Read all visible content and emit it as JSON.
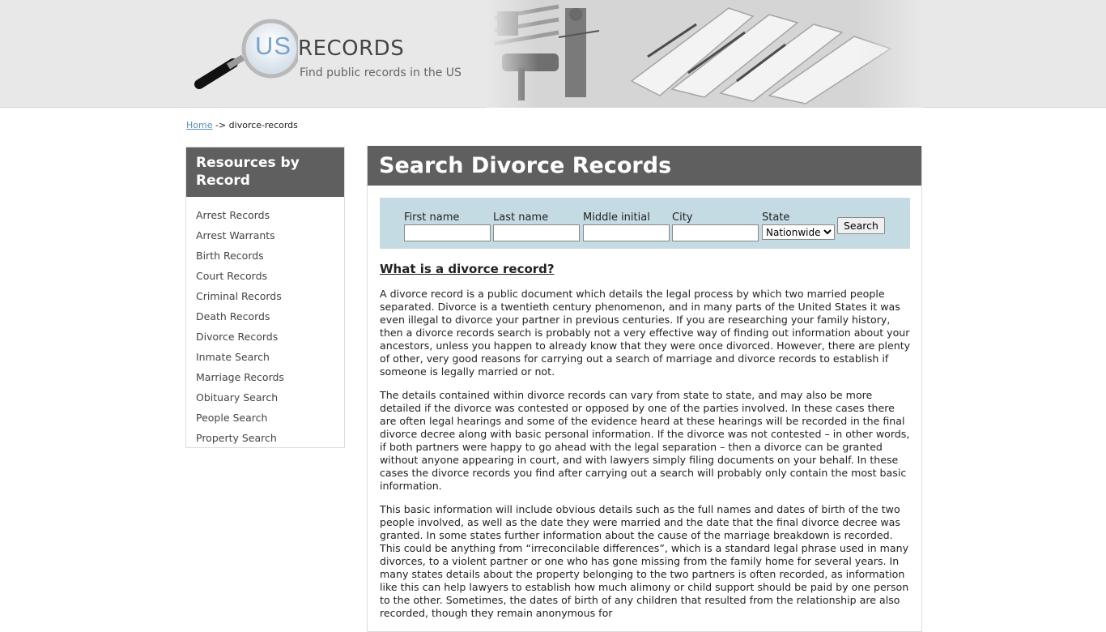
{
  "header": {
    "logo_us": "US",
    "logo_records": "RECORDS",
    "tagline": "Find public records in the US"
  },
  "breadcrumb": {
    "home": "Home",
    "separator": "->",
    "current": "divorce-records"
  },
  "sidebar": {
    "title": "Resources by Record",
    "items": [
      "Arrest Records",
      "Arrest Warrants",
      "Birth Records",
      "Court Records",
      "Criminal Records",
      "Death Records",
      "Divorce Records",
      "Inmate Search",
      "Marriage Records",
      "Obituary Search",
      "People Search",
      "Property Search"
    ]
  },
  "main": {
    "title": "Search Divorce Records",
    "search": {
      "first_name_label": "First name",
      "last_name_label": "Last name",
      "middle_initial_label": "Middle initial",
      "city_label": "City",
      "state_label": "State",
      "state_selected": "Nationwide",
      "button_label": "Search"
    },
    "heading": "What is a divorce record?",
    "paragraphs": [
      "A divorce record is a public document which details the legal process by which two married people separated. Divorce is a twentieth century phenomenon, and in many parts of the United States it was even illegal to divorce your partner in previous centuries. If you are researching your family history, then a divorce records search is probably not a very effective way of finding out information about your ancestors, unless you happen to already know that they were once divorced. However, there are plenty of other, very good reasons for carrying out a search of marriage and divorce records to establish if someone is legally married or not.",
      "The details contained within divorce records can vary from state to state, and may also be more detailed if the divorce was contested or opposed by one of the parties involved. In these cases there are often legal hearings and some of the evidence heard at these hearings will be recorded in the final divorce decree along with basic personal information. If the divorce was not contested – in other words, if both partners were happy to go ahead with the legal separation – then a divorce can be granted without anyone appearing in court, and with lawyers simply filing documents on your behalf. In these cases the divorce records you find after carrying out a search will probably only contain the most basic information.",
      "This basic information will include obvious details such as the full names and dates of birth of the two people involved, as well as the date they were married and the date that the final divorce decree was granted. In some states further information about the cause of the marriage breakdown is recorded. This could be anything from “irreconcilable differences”, which is a standard legal phrase used in many divorces, to a violent partner or one who has gone missing from the family home for several years. In many states details about the property belonging to the two partners is often recorded, as information like this can help lawyers to establish how much alimony or child support should be paid by one person to the other. Sometimes, the dates of birth of any children that resulted from the relationship are also recorded, though they remain anonymous for"
    ]
  }
}
